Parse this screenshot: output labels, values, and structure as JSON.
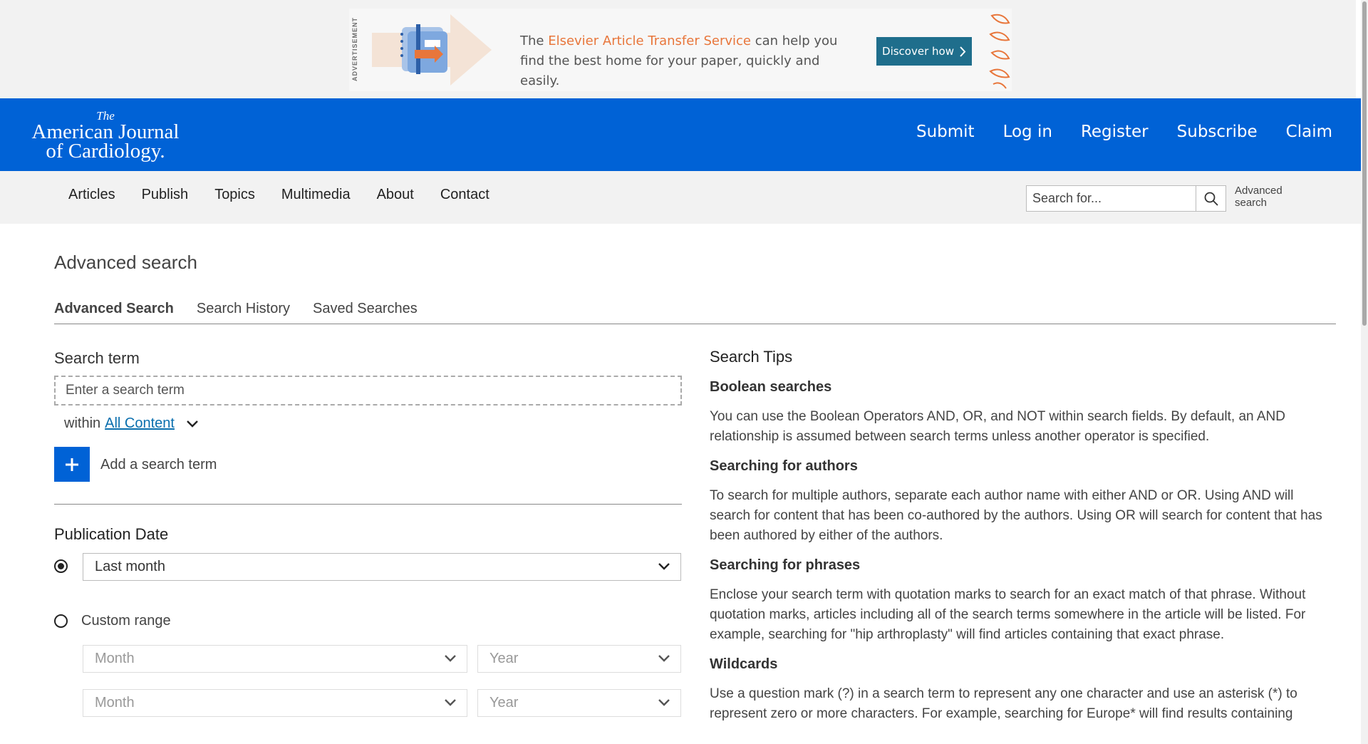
{
  "ad": {
    "tag": "ADVERTISEMENT",
    "text_pre": "The ",
    "text_highlight": "Elsevier Article Transfer Service",
    "text_post": " can help you find the best home for your paper, quickly and easily.",
    "cta": "Discover how"
  },
  "header": {
    "logo_the": "The",
    "logo_line1": "American Journal",
    "logo_line2": "of Cardiology.",
    "nav": [
      "Submit",
      "Log in",
      "Register",
      "Subscribe",
      "Claim"
    ]
  },
  "subnav": {
    "items": [
      "Articles",
      "Publish",
      "Topics",
      "Multimedia",
      "About",
      "Contact"
    ],
    "search_placeholder": "Search for...",
    "advanced_link": "Advanced search"
  },
  "page": {
    "title": "Advanced search",
    "tabs": [
      "Advanced Search",
      "Search History",
      "Saved Searches"
    ],
    "active_tab": "Advanced Search"
  },
  "form": {
    "search_term_label": "Search term",
    "search_term_placeholder": "Enter a search term",
    "within_label": "within",
    "within_value": "All Content",
    "add_term_label": "Add a search term",
    "publication_date_label": "Publication Date",
    "last_value": "Last month",
    "custom_range_label": "Custom range",
    "month_placeholder": "Month",
    "year_placeholder": "Year",
    "selected_option": "Last month"
  },
  "tips": {
    "title": "Search Tips",
    "sections": [
      {
        "heading": "Boolean searches",
        "body": "You can use the Boolean Operators AND, OR, and NOT within search fields. By default, an AND relationship is assumed between search terms unless another operator is specified."
      },
      {
        "heading": "Searching for authors",
        "body": "To search for multiple authors, separate each author name with either AND or OR. Using AND will search for content that has been co-authored by the authors. Using OR will search for content that has been authored by either of the authors."
      },
      {
        "heading": "Searching for phrases",
        "body": "Enclose your search term with quotation marks to search for an exact match of that phrase. Without quotation marks, articles including all of the search terms somewhere in the article will be listed. For example, searching for \"hip arthroplasty\" will find articles containing that exact phrase."
      },
      {
        "heading": "Wildcards",
        "body": "Use a question mark (?) in a search term to represent any one character and use an asterisk (*) to represent zero or more characters. For example, searching for Europe* will find results containing"
      }
    ]
  },
  "colors": {
    "brand_blue": "#0062d6",
    "ad_orange": "#e8763b",
    "ad_button": "#1f6e8c",
    "link": "#0a6fae"
  }
}
